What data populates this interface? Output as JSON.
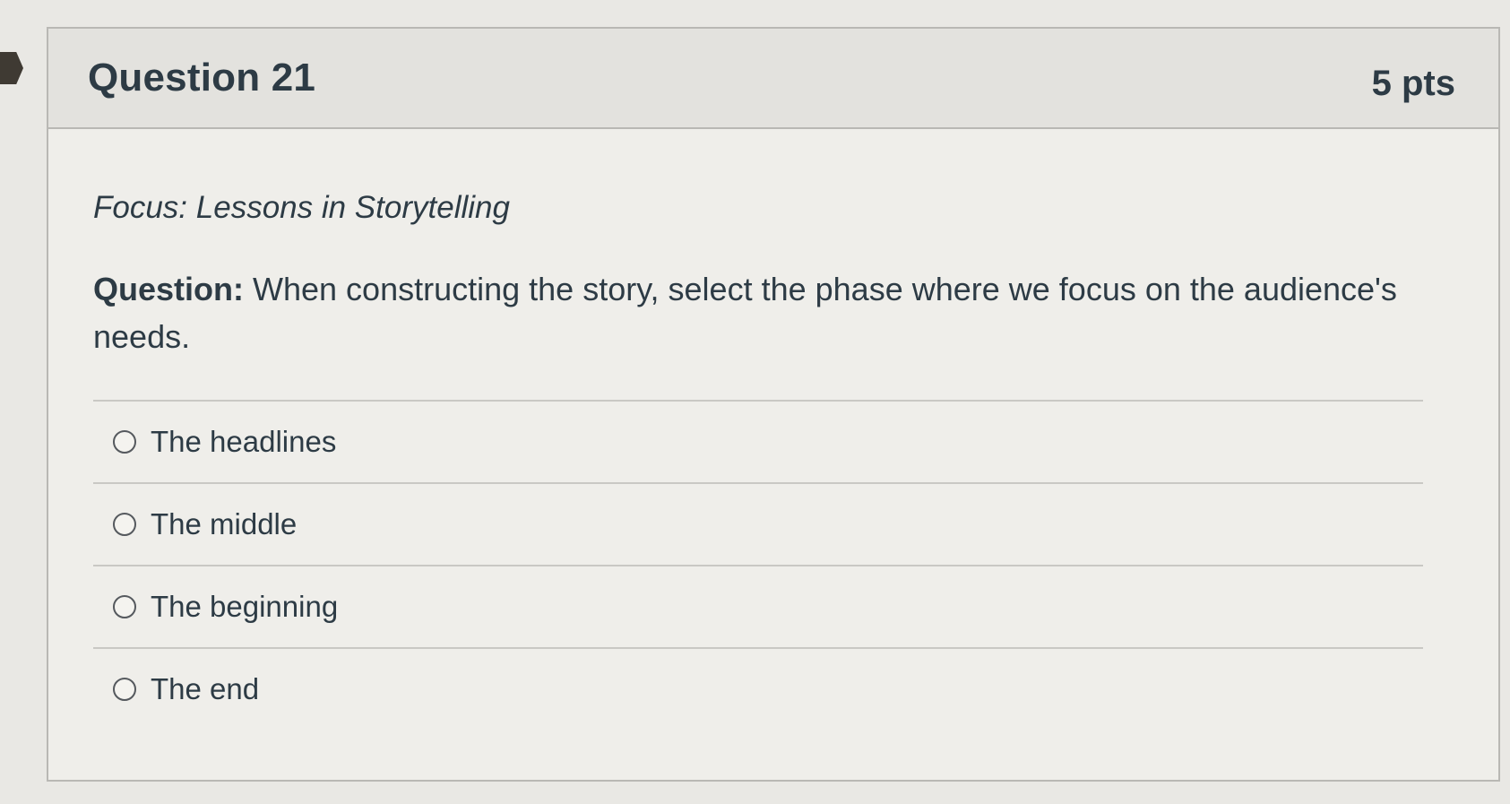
{
  "question": {
    "title": "Question 21",
    "points": "5 pts",
    "focus": "Focus: Lessons in Storytelling",
    "prompt_label": "Question:",
    "prompt_text": " When constructing the story, select the phase where we focus on the audience's needs.",
    "answers": [
      {
        "label": "The headlines",
        "selected": false
      },
      {
        "label": "The middle",
        "selected": false
      },
      {
        "label": "The beginning",
        "selected": false
      },
      {
        "label": "The end",
        "selected": false
      }
    ]
  },
  "colors": {
    "text": "#2d3b45",
    "header_bg": "#e3e2de",
    "card_bg": "#efeeea",
    "border": "#b9b8b4",
    "flag": "#3f3a33"
  }
}
